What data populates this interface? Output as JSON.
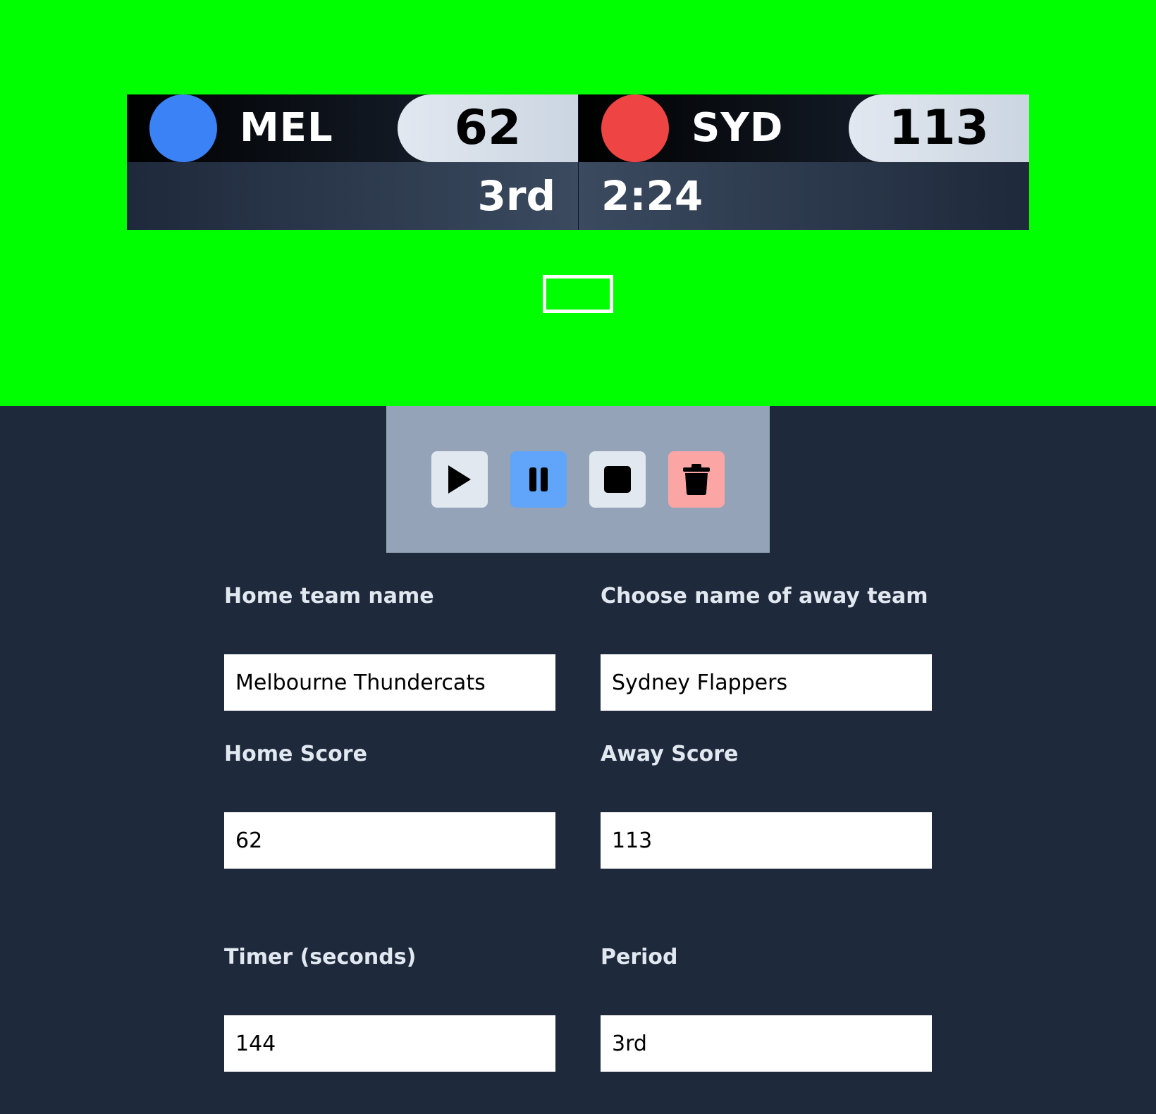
{
  "scoreboard": {
    "home": {
      "abbr": "MEL",
      "score": "62",
      "color": "#3b82f6"
    },
    "away": {
      "abbr": "SYD",
      "score": "113",
      "color": "#ef4444"
    },
    "period": "3rd",
    "clock": "2:24"
  },
  "controls": {
    "play_icon": "play-icon",
    "pause_icon": "pause-icon",
    "stop_icon": "stop-icon",
    "delete_icon": "trash-icon"
  },
  "form": {
    "home_name": {
      "label": "Home team name",
      "value": "Melbourne Thundercats"
    },
    "away_name": {
      "label": "Choose name of away team",
      "value": "Sydney Flappers"
    },
    "home_score": {
      "label": "Home Score",
      "value": "62"
    },
    "away_score": {
      "label": "Away Score",
      "value": "113"
    },
    "timer": {
      "label": "Timer (seconds)",
      "value": "144"
    },
    "period": {
      "label": "Period",
      "value": "3rd"
    }
  },
  "colors": {
    "chroma_background": "#00ff00",
    "panel_background": "#1e293b",
    "controls_background": "#94a3b8",
    "pause_button": "#60a5fa",
    "delete_button": "#fca5a5"
  }
}
